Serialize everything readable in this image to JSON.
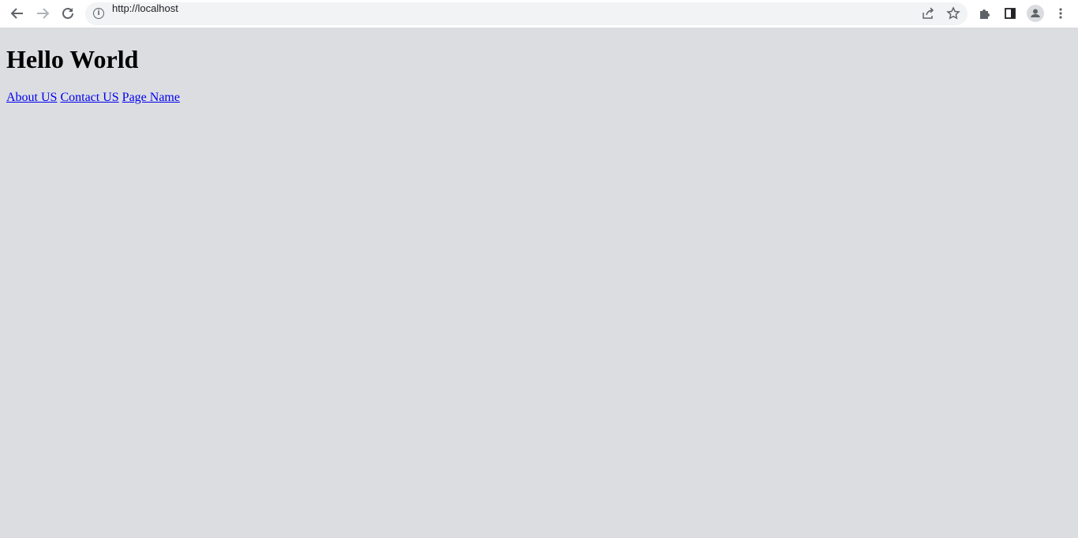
{
  "browser": {
    "url": "http://localhost",
    "icons": [
      "back-icon",
      "forward-icon",
      "reload-icon",
      "info-icon",
      "share-icon",
      "star-icon",
      "extensions-icon",
      "side-panel-icon",
      "profile-icon",
      "menu-icon"
    ]
  },
  "page": {
    "heading": "Hello World",
    "links": [
      {
        "label": "About US"
      },
      {
        "label": "Contact US"
      },
      {
        "label": "Page Name"
      }
    ]
  },
  "colors": {
    "background": "#dcdde1",
    "link": "#0000ee"
  }
}
